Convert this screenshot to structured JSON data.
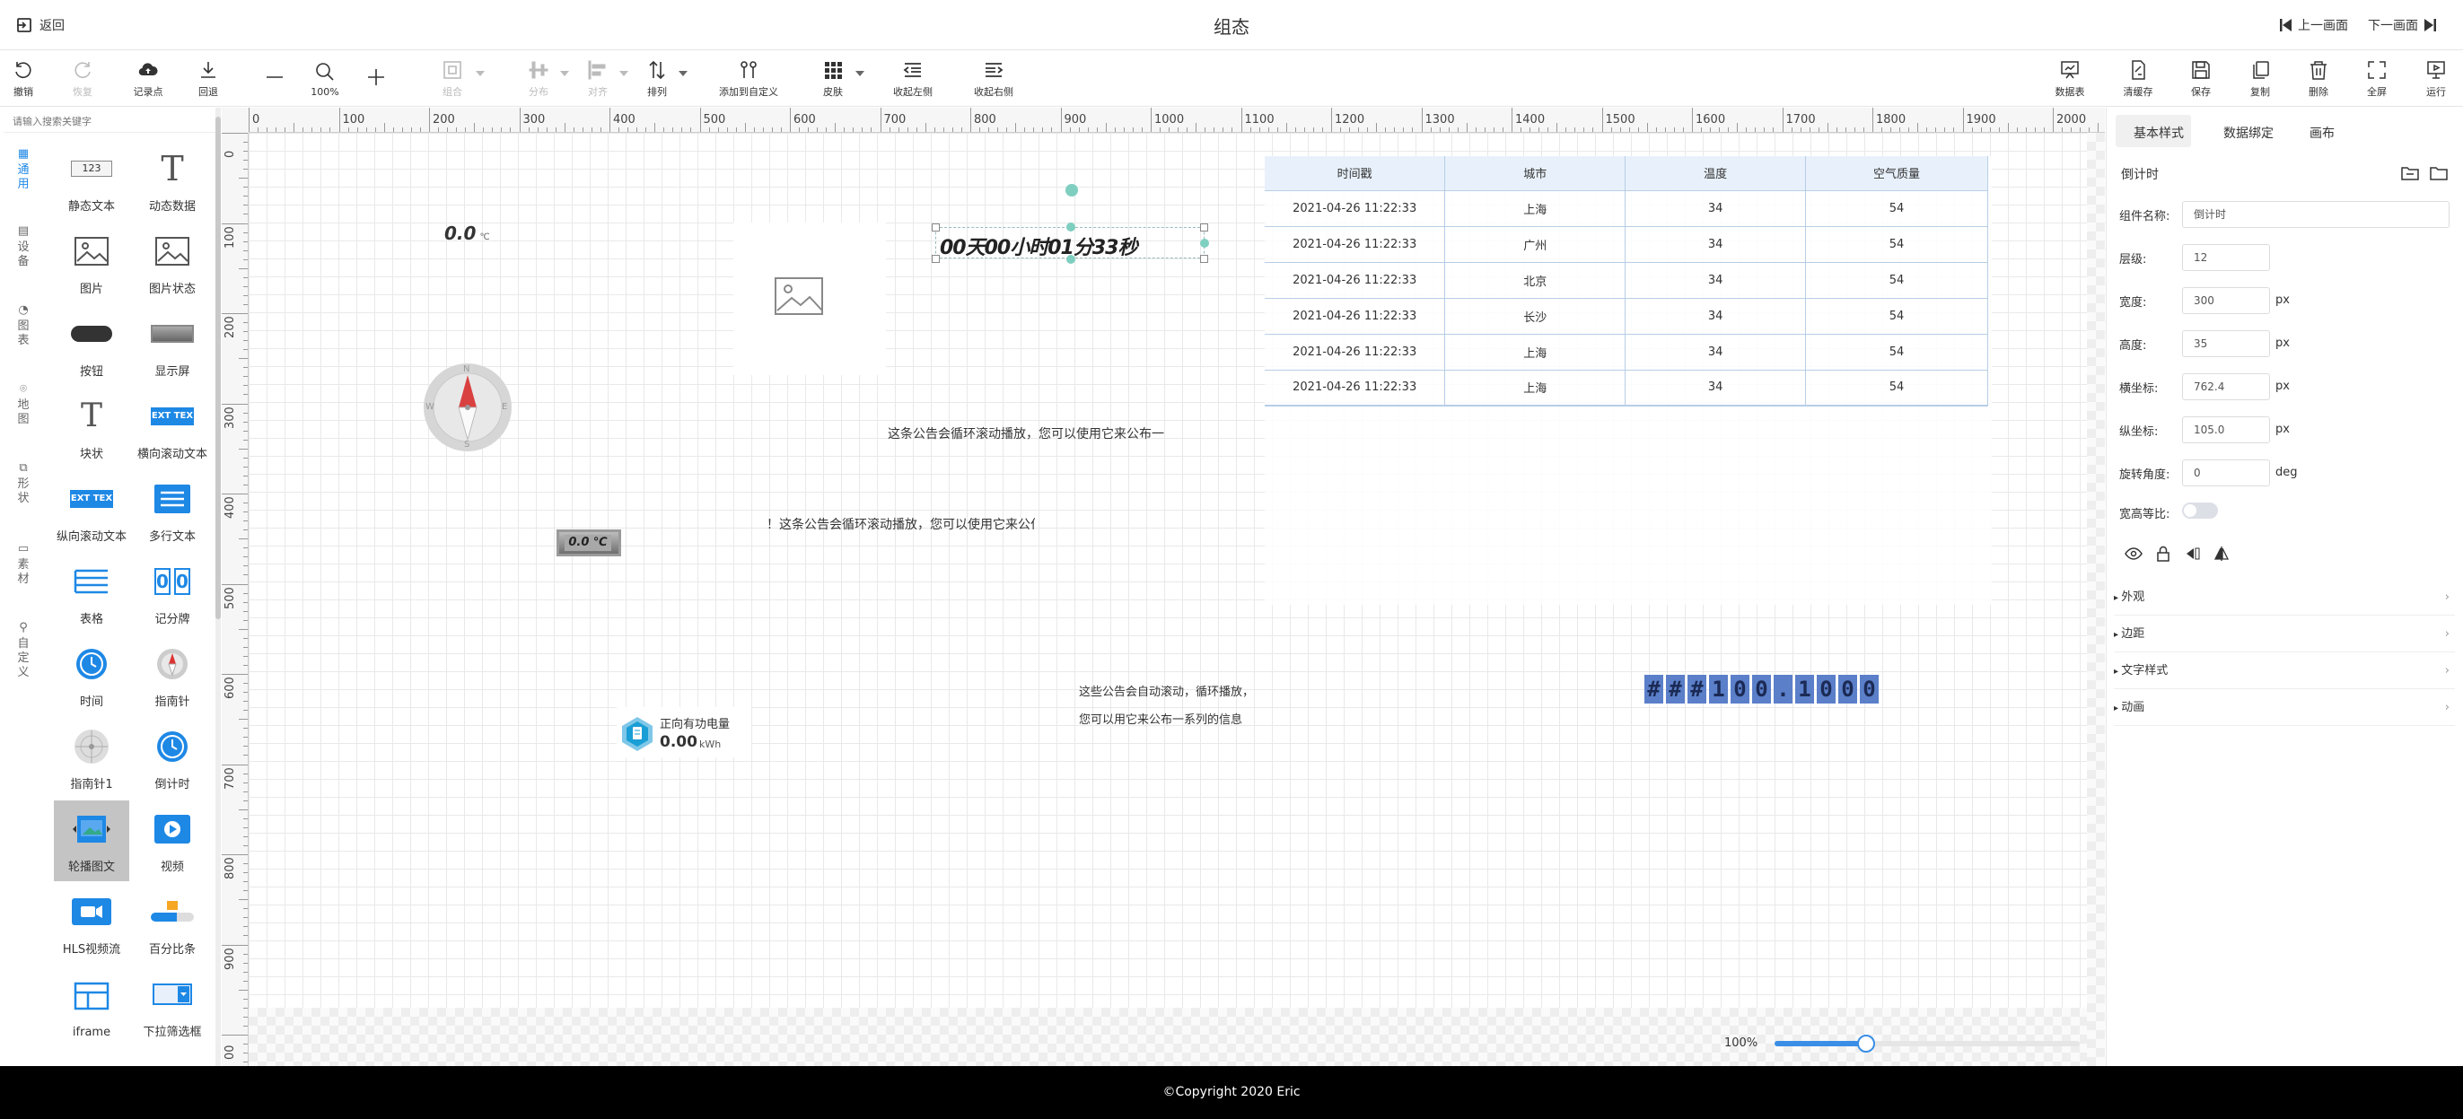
{
  "header": {
    "back_label": "返回",
    "title": "组态",
    "prev_label": "上一画面",
    "next_label": "下一画面"
  },
  "toolbar": {
    "undo": "撤销",
    "redo": "恢复",
    "record": "记录点",
    "rollback": "回退",
    "zoom_value": "100%",
    "group": "组合",
    "distribute": "分布",
    "align": "对齐",
    "arrange": "排列",
    "add_custom": "添加到自定义",
    "skin": "皮肤",
    "collapse_left": "收起左侧",
    "collapse_right": "收起右侧",
    "data_table": "数据表",
    "clear_cache": "清缓存",
    "save": "保存",
    "copy": "复制",
    "delete": "删除",
    "fullscreen": "全屏",
    "run": "运行"
  },
  "left": {
    "search_placeholder": "请输入搜索关键字",
    "categories": [
      "通用",
      "设备",
      "图表",
      "地图",
      "形状",
      "素材",
      "自定义"
    ],
    "components": [
      "静态文本",
      "动态数据",
      "图片",
      "图片状态",
      "按钮",
      "显示屏",
      "块状",
      "横向滚动文本",
      "纵向滚动文本",
      "多行文本",
      "表格",
      "记分牌",
      "时间",
      "指南针",
      "指南针1",
      "倒计时",
      "轮播图文",
      "视频",
      "HLS视频流",
      "百分比条",
      "iframe",
      "下拉筛选框"
    ],
    "icon_123": "123",
    "icon_text_t": "T",
    "icon_scroll_text": "EXT TEX",
    "icon_score": "0"
  },
  "ruler": {
    "h": [
      "0",
      "100",
      "200",
      "300",
      "400",
      "500",
      "600",
      "700",
      "800",
      "900",
      "1000",
      "1100",
      "1200",
      "1300",
      "1400",
      "1500",
      "1600",
      "1700",
      "1800",
      "1900",
      "2000"
    ],
    "v": [
      "0",
      "100",
      "200",
      "300",
      "400",
      "500",
      "600",
      "700",
      "800",
      "900",
      "00"
    ]
  },
  "stage": {
    "dyn_value": "0.0",
    "dyn_unit": "℃",
    "countdown": "00天00小时01分33秒",
    "notice1": "这条公告会循环滚动播放，您可以使用它来公布一",
    "notice2": "！这条公告会循环滚动播放，您可以使用它来公仆",
    "display_value": "0.0 ℃",
    "energy_title": "正向有功电量",
    "energy_value": "0.00",
    "energy_unit": "kWh",
    "multiline": [
      "这些公告会自动滚动，循环播放，",
      "您可以用它来公布一系列的信息"
    ],
    "scoreboard": "###100.1000",
    "compass_letters": {
      "n": "N",
      "s": "S",
      "e": "E",
      "w": "W"
    },
    "table": {
      "headers": [
        "时间戳",
        "城市",
        "温度",
        "空气质量"
      ],
      "rows": [
        [
          "2021-04-26 11:22:33",
          "上海",
          "34",
          "54"
        ],
        [
          "2021-04-26 11:22:33",
          "广州",
          "34",
          "54"
        ],
        [
          "2021-04-26 11:22:33",
          "北京",
          "34",
          "54"
        ],
        [
          "2021-04-26 11:22:33",
          "长沙",
          "34",
          "54"
        ],
        [
          "2021-04-26 11:22:33",
          "上海",
          "34",
          "54"
        ],
        [
          "2021-04-26 11:22:33",
          "上海",
          "34",
          "54"
        ]
      ]
    },
    "zoom_label": "100%",
    "zoom_level": 0.3
  },
  "right": {
    "tabs": [
      "基本样式",
      "数据绑定",
      "画布"
    ],
    "section_title": "倒计时",
    "fields": [
      {
        "label": "组件名称:",
        "value": "倒计时",
        "unit": ""
      },
      {
        "label": "层级:",
        "value": "12",
        "unit": ""
      },
      {
        "label": "宽度:",
        "value": "300",
        "unit": "px"
      },
      {
        "label": "高度:",
        "value": "35",
        "unit": "px"
      },
      {
        "label": "横坐标:",
        "value": "762.4",
        "unit": "px"
      },
      {
        "label": "纵坐标:",
        "value": "105.0",
        "unit": "px"
      },
      {
        "label": "旋转角度:",
        "value": "0",
        "unit": "deg"
      }
    ],
    "ratio_label": "宽高等比:",
    "collapsibles": [
      "外观",
      "边距",
      "文字样式",
      "动画"
    ]
  },
  "footer": {
    "copyright": "©Copyright 2020 Eric"
  },
  "colors": {
    "accent": "#1e88e5",
    "handle": "#7ecfc0",
    "scoreboard_bg": "#5b7fc9",
    "table_border": "#b7cde6"
  }
}
